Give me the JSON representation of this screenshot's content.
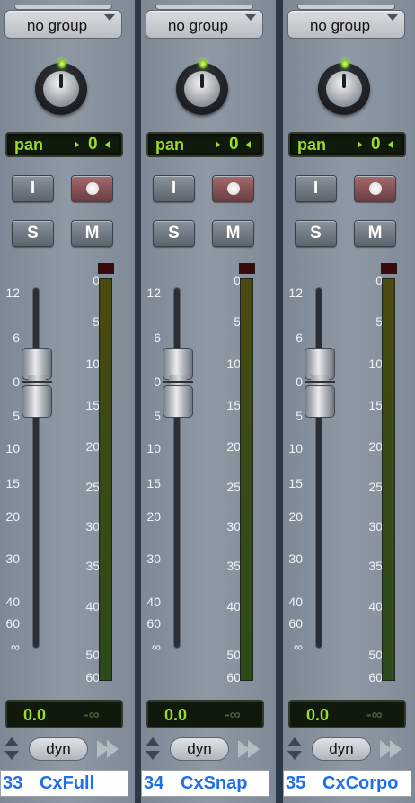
{
  "channels": [
    {
      "group": "no group",
      "pan_label": "pan",
      "pan_value": "0",
      "input_label": "I",
      "solo_label": "S",
      "mute_label": "M",
      "volume": "0.0",
      "peak": "-∞",
      "automation_mode": "dyn",
      "number": "33",
      "name": "CxFull"
    },
    {
      "group": "no group",
      "pan_label": "pan",
      "pan_value": "0",
      "input_label": "I",
      "solo_label": "S",
      "mute_label": "M",
      "volume": "0.0",
      "peak": "-∞",
      "automation_mode": "dyn",
      "number": "34",
      "name": "CxSnap"
    },
    {
      "group": "no group",
      "pan_label": "pan",
      "pan_value": "0",
      "input_label": "I",
      "solo_label": "S",
      "mute_label": "M",
      "volume": "0.0",
      "peak": "-∞",
      "automation_mode": "dyn",
      "number": "35",
      "name": "CxCorpo"
    }
  ],
  "fader_scale": [
    "12",
    "6",
    "0",
    "5",
    "10",
    "15",
    "20",
    "30",
    "40",
    "60",
    "∞"
  ],
  "meter_scale": [
    "0",
    "5",
    "10",
    "15",
    "20",
    "25",
    "30",
    "35",
    "40",
    "50",
    "60"
  ],
  "colors": {
    "lcd_text": "#9bdc2b",
    "name_text": "#1f6fe8",
    "strip_bg": "#8f99a4"
  }
}
